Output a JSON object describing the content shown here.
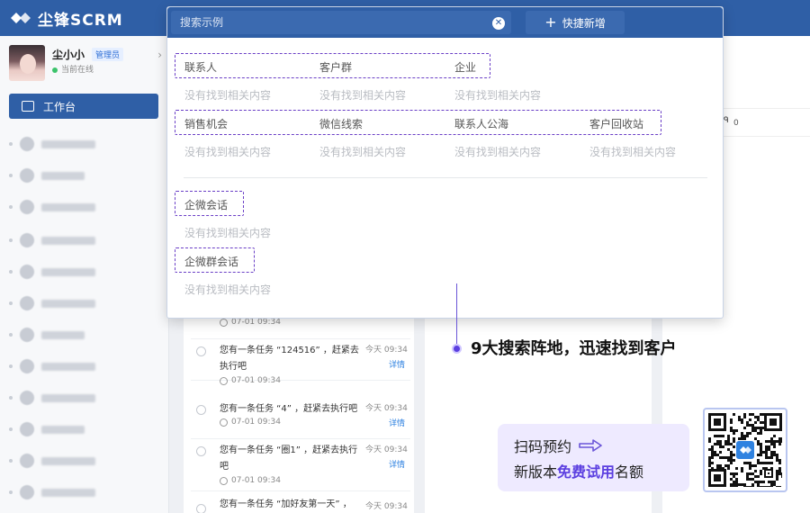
{
  "brand": {
    "name": "尘锋SCRM"
  },
  "profile": {
    "name": "尘小小",
    "role": "管理员",
    "status": "当前在线"
  },
  "sidebar": {
    "workbench_label": "工作台"
  },
  "search": {
    "placeholder": "搜索示例",
    "quick_add_label": "快捷新增",
    "empty_text": "没有找到相关内容",
    "group1": [
      "联系人",
      "客户群",
      "企业"
    ],
    "group2": [
      "销售机会",
      "微信线索",
      "联系人公海",
      "客户回收站"
    ],
    "group3": [
      "企微会话"
    ],
    "group4": [
      "企微群会话"
    ]
  },
  "tasks": [
    {
      "time": "07-01 09:34"
    },
    {
      "text": "您有一条任务 “124516” ，赶紧去执行吧",
      "day": "今天 09:34",
      "detail": "详情",
      "time": "07-01 09:34"
    },
    {
      "text": "您有一条任务 “4” ，赶紧去执行吧",
      "day": "今天 09:34",
      "detail": "详情",
      "time": "07-01 09:34"
    },
    {
      "text": "您有一条任务 “圈1” ，赶紧去执行吧",
      "day": "今天 09:34",
      "detail": "详情",
      "time": "07-01 09:34"
    },
    {
      "text": "您有一条任务 “加好友第一天” ，",
      "day": "今天 09:34"
    }
  ],
  "col3": {
    "count": "0"
  },
  "annotation": {
    "text": "9大搜索阵地，迅速找到客户"
  },
  "promo": {
    "line1": "扫码预约",
    "line2_prefix": "新版本",
    "line2_highlight": "免费试用",
    "line2_suffix": "名额"
  },
  "colors": {
    "primary": "#2f5fa6",
    "accent": "#5b3fe0",
    "dashed_box": "#6a3fc6"
  }
}
